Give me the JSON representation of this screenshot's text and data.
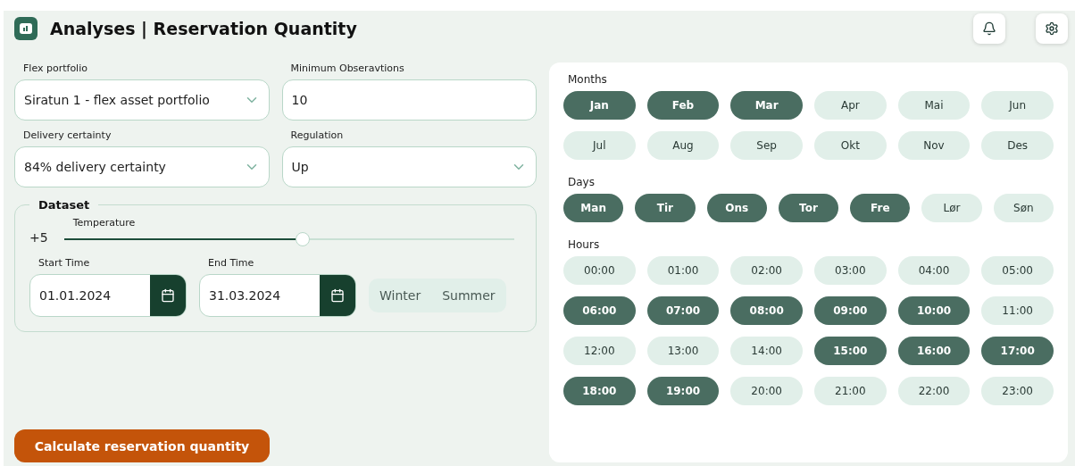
{
  "header": {
    "title": "Analyses | Reservation Quantity"
  },
  "form": {
    "flex_portfolio": {
      "label": "Flex portfolio",
      "value": "Siratun 1 - flex asset portfolio"
    },
    "minimum_observations": {
      "label": "Minimum Obseravtions",
      "value": "10"
    },
    "delivery_certainty": {
      "label": "Delivery certainty",
      "value": "84% delivery certainty"
    },
    "regulation": {
      "label": "Regulation",
      "value": "Up"
    }
  },
  "dataset": {
    "title": "Dataset",
    "slider": {
      "reading": "+5",
      "label": "Temperature",
      "level": 0.53
    },
    "start_time": {
      "label": "Start Time",
      "value": "01.01.2024"
    },
    "end_time": {
      "label": "End Time",
      "value": "31.03.2024"
    },
    "seasons": [
      "Winter",
      "Summer"
    ]
  },
  "action_button": "Calculate reservation quantity",
  "months": {
    "label": "Months",
    "items": [
      {
        "label": "Jan",
        "selected": true
      },
      {
        "label": "Feb",
        "selected": true
      },
      {
        "label": "Mar",
        "selected": true
      },
      {
        "label": "Apr",
        "selected": false
      },
      {
        "label": "Mai",
        "selected": false
      },
      {
        "label": "Jun",
        "selected": false
      },
      {
        "label": "Jul",
        "selected": false
      },
      {
        "label": "Aug",
        "selected": false
      },
      {
        "label": "Sep",
        "selected": false
      },
      {
        "label": "Okt",
        "selected": false
      },
      {
        "label": "Nov",
        "selected": false
      },
      {
        "label": "Des",
        "selected": false
      }
    ]
  },
  "days": {
    "label": "Days",
    "items": [
      {
        "label": "Man",
        "selected": true
      },
      {
        "label": "Tir",
        "selected": true
      },
      {
        "label": "Ons",
        "selected": true
      },
      {
        "label": "Tor",
        "selected": true
      },
      {
        "label": "Fre",
        "selected": true
      },
      {
        "label": "Lør",
        "selected": false
      },
      {
        "label": "Søn",
        "selected": false
      }
    ]
  },
  "hours": {
    "label": "Hours",
    "items": [
      {
        "label": "00:00",
        "selected": false
      },
      {
        "label": "01:00",
        "selected": false
      },
      {
        "label": "02:00",
        "selected": false
      },
      {
        "label": "03:00",
        "selected": false
      },
      {
        "label": "04:00",
        "selected": false
      },
      {
        "label": "05:00",
        "selected": false
      },
      {
        "label": "06:00",
        "selected": true
      },
      {
        "label": "07:00",
        "selected": true
      },
      {
        "label": "08:00",
        "selected": true
      },
      {
        "label": "09:00",
        "selected": true
      },
      {
        "label": "10:00",
        "selected": true
      },
      {
        "label": "11:00",
        "selected": false
      },
      {
        "label": "12:00",
        "selected": false
      },
      {
        "label": "13:00",
        "selected": false
      },
      {
        "label": "14:00",
        "selected": false
      },
      {
        "label": "15:00",
        "selected": true
      },
      {
        "label": "16:00",
        "selected": true
      },
      {
        "label": "17:00",
        "selected": true
      },
      {
        "label": "18:00",
        "selected": true
      },
      {
        "label": "19:00",
        "selected": true
      },
      {
        "label": "20:00",
        "selected": false
      },
      {
        "label": "21:00",
        "selected": false
      },
      {
        "label": "22:00",
        "selected": false
      },
      {
        "label": "23:00",
        "selected": false
      }
    ]
  }
}
